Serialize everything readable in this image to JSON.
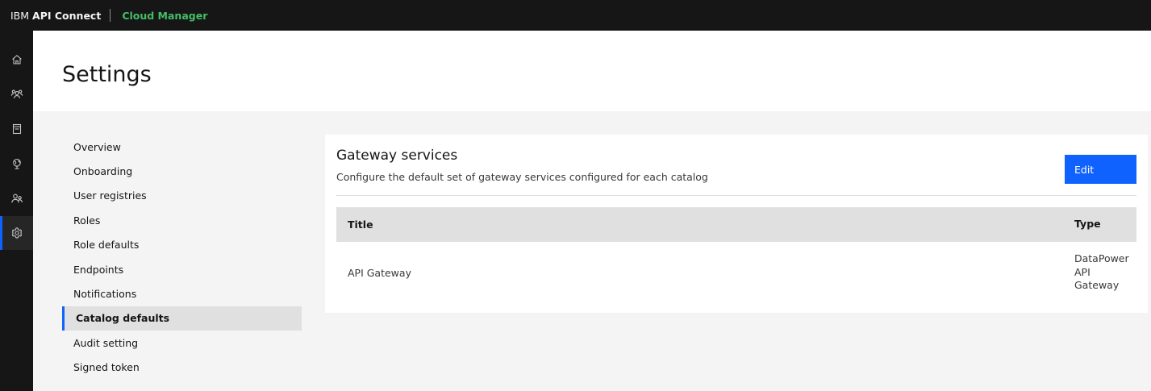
{
  "topbar": {
    "brand_ibm": "IBM",
    "brand_product": "API Connect",
    "app_name": "Cloud Manager"
  },
  "rail": {
    "items": [
      {
        "icon": "home-icon"
      },
      {
        "icon": "users-icon"
      },
      {
        "icon": "document-icon"
      },
      {
        "icon": "globe-icon"
      },
      {
        "icon": "members-icon"
      },
      {
        "icon": "settings-icon",
        "active": true
      }
    ]
  },
  "page": {
    "title": "Settings"
  },
  "subnav": {
    "items": [
      {
        "label": "Overview"
      },
      {
        "label": "Onboarding"
      },
      {
        "label": "User registries"
      },
      {
        "label": "Roles"
      },
      {
        "label": "Role defaults"
      },
      {
        "label": "Endpoints"
      },
      {
        "label": "Notifications"
      },
      {
        "label": "Catalog defaults",
        "active": true
      },
      {
        "label": "Audit setting"
      },
      {
        "label": "Signed token"
      }
    ]
  },
  "panel": {
    "title": "Gateway services",
    "description": "Configure the default set of gateway services configured for each catalog",
    "edit_label": "Edit",
    "table": {
      "headers": [
        "Title",
        "Type"
      ],
      "rows": [
        {
          "title": "API Gateway",
          "type": "DataPower API Gateway"
        }
      ]
    }
  },
  "colors": {
    "accent": "#0f62fe",
    "app_name": "#42be65",
    "topbar": "#161616"
  }
}
